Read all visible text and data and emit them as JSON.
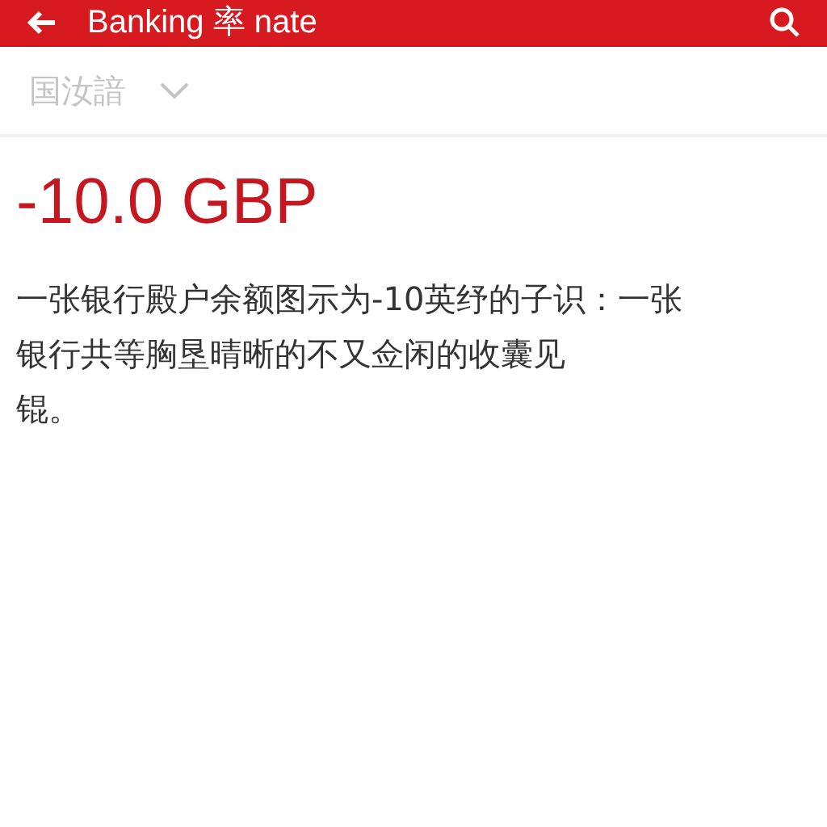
{
  "header": {
    "title": "Banking 率 nate"
  },
  "dropdown": {
    "label": "国汝諳"
  },
  "balance": {
    "amount": "-10.0 GBP"
  },
  "description_lines": [
    "一张银行殿户余额图示为-10英纾的子识：一张",
    "银行共等胸垦晴晰的不又佥闲的收囊见",
    "锟。"
  ]
}
